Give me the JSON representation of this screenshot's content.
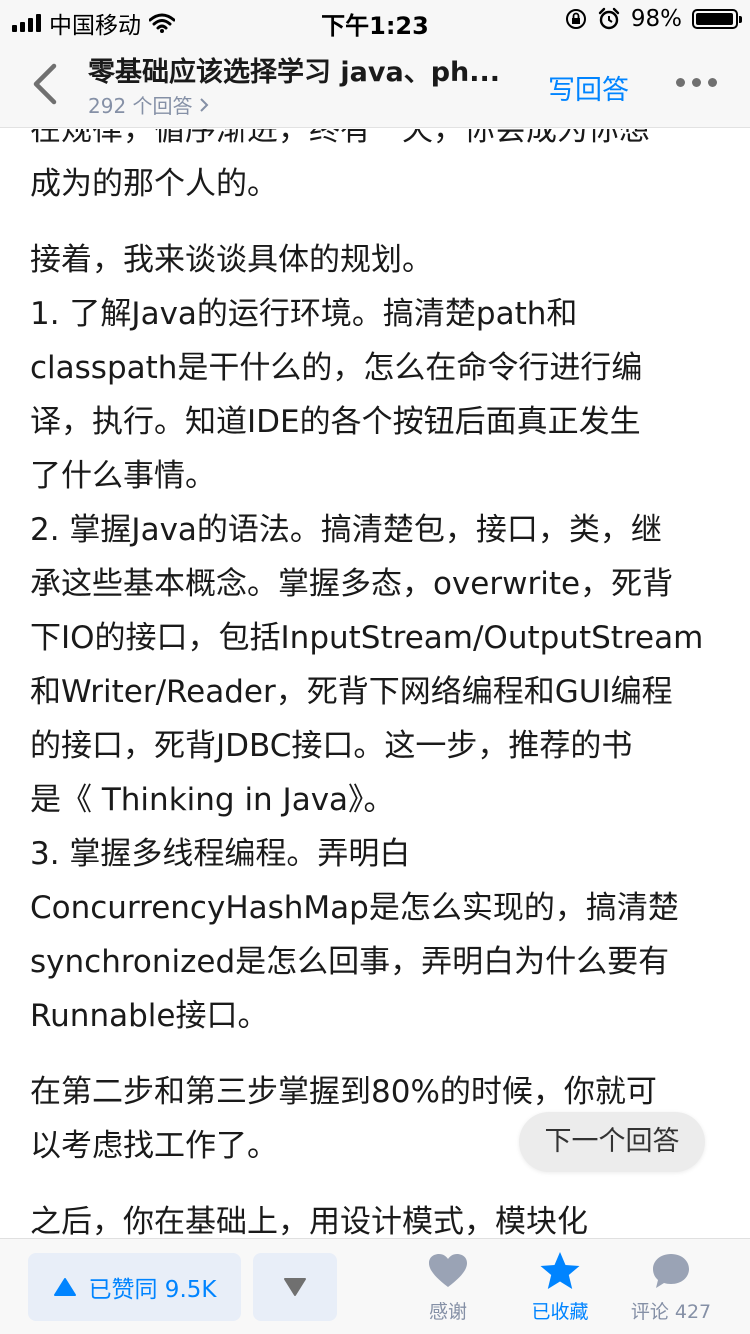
{
  "status_bar": {
    "carrier": "中国移动",
    "time": "下午1:23",
    "battery_text": "98%",
    "battery_level": 0.98
  },
  "nav": {
    "title": "零基础应该选择学习 java、ph...",
    "answers_count": "292 个回答",
    "write_answer": "写回答"
  },
  "content": {
    "lines": [
      "在规律，循序渐进，终有一天，你会成为你想",
      "成为的那个人的。",
      "",
      "接着，我来谈谈具体的规划。",
      "1. 了解Java的运行环境。搞清楚path和",
      "classpath是干什么的，怎么在命令行进行编",
      "译，执行。知道IDE的各个按钮后面真正发生",
      "了什么事情。",
      "2. 掌握Java的语法。搞清楚包，接口，类，继",
      "承这些基本概念。掌握多态，overwrite，死背",
      "下IO的接口，包括InputStream/OutputStream",
      "和Writer/Reader，死背下网络编程和GUI编程",
      "的接口，死背JDBC接口。这一步，推荐的书",
      "是《 Thinking in Java》。",
      "3. 掌握多线程编程。弄明白",
      "ConcurrencyHashMap是怎么实现的，搞清楚",
      "synchronized是怎么回事，弄明白为什么要有",
      "Runnable接口。",
      "",
      "在第二步和第三步掌握到80%的时候，你就可",
      "以考虑找工作了。",
      "",
      "之后，你在基础上，用设计模式，模块化"
    ]
  },
  "next_answer": "下一个回答",
  "bottom_bar": {
    "upvote_label": "已赞同 9.5K",
    "thanks_label": "感谢",
    "collected_label": "已收藏",
    "comment_label": "评论 427"
  },
  "colors": {
    "accent": "#0084ff",
    "muted": "#8590a6"
  }
}
